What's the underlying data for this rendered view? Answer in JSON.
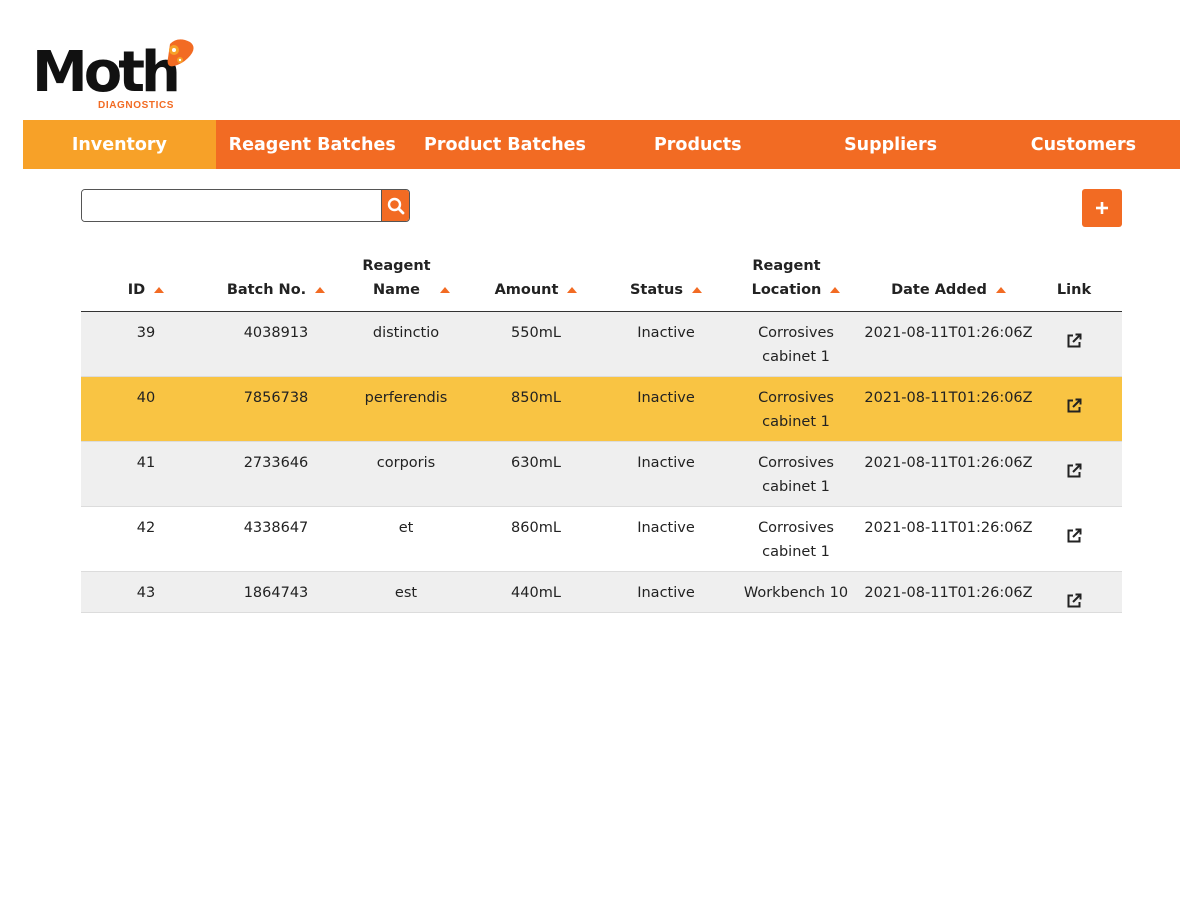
{
  "brand": {
    "name": "Moth",
    "tagline": "DIAGNOSTICS",
    "accent": "#f26b23",
    "active_tab": "#f7a128",
    "highlight_row": "#f9c443"
  },
  "nav": [
    {
      "label": "Inventory",
      "active": true
    },
    {
      "label": "Reagent Batches"
    },
    {
      "label": "Product Batches"
    },
    {
      "label": "Products"
    },
    {
      "label": "Suppliers"
    },
    {
      "label": "Customers"
    }
  ],
  "search": {
    "value": "",
    "placeholder": "",
    "icon": "search-icon"
  },
  "add_button": {
    "icon": "plus-icon"
  },
  "table": {
    "headers": [
      {
        "label": "ID",
        "sortable": true
      },
      {
        "label": "Batch No.",
        "sortable": true
      },
      {
        "label": "Reagent\nName",
        "sortable": true
      },
      {
        "label": "Amount",
        "sortable": true
      },
      {
        "label": "Status",
        "sortable": true
      },
      {
        "label": "Reagent\nLocation",
        "sortable": true
      },
      {
        "label": "Date Added",
        "sortable": true
      },
      {
        "label": "Link",
        "sortable": false
      }
    ],
    "rows": [
      {
        "id": "39",
        "batch": "4038913",
        "name": "distinctio",
        "amount": "550mL",
        "status": "Inactive",
        "location": "Corrosives\ncabinet 1",
        "date": "2021-08-11T01:26:06Z"
      },
      {
        "id": "40",
        "batch": "7856738",
        "name": "perferendis",
        "amount": "850mL",
        "status": "Inactive",
        "location": "Corrosives\ncabinet 1",
        "date": "2021-08-11T01:26:06Z"
      },
      {
        "id": "41",
        "batch": "2733646",
        "name": "corporis",
        "amount": "630mL",
        "status": "Inactive",
        "location": "Corrosives\ncabinet 1",
        "date": "2021-08-11T01:26:06Z"
      },
      {
        "id": "42",
        "batch": "4338647",
        "name": "et",
        "amount": "860mL",
        "status": "Inactive",
        "location": "Corrosives\ncabinet 1",
        "date": "2021-08-11T01:26:06Z"
      },
      {
        "id": "43",
        "batch": "1864743",
        "name": "est",
        "amount": "440mL",
        "status": "Inactive",
        "location": "Workbench 10",
        "date": "2021-08-11T01:26:06Z"
      }
    ],
    "link_icon": "external-link-icon"
  }
}
